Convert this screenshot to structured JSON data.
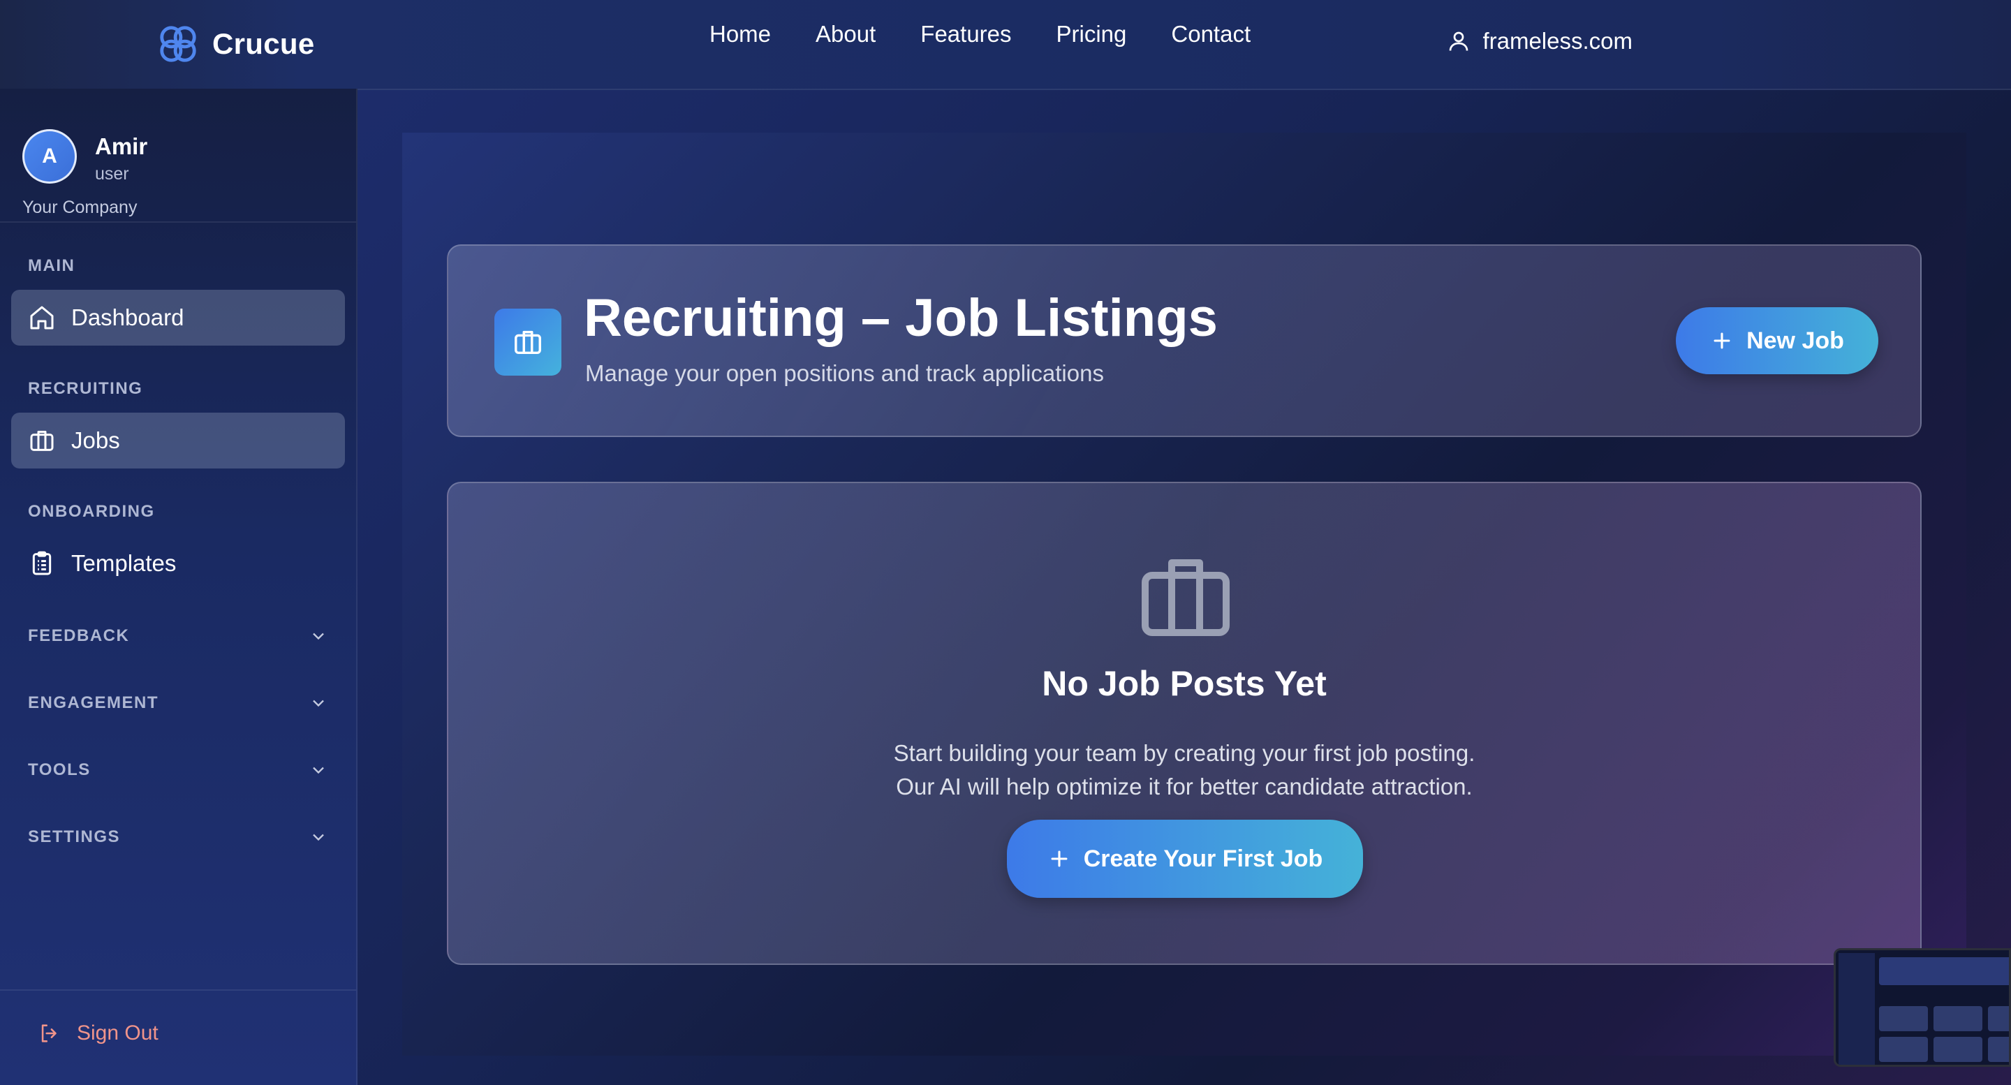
{
  "brand": {
    "name": "Crucue"
  },
  "nav": {
    "links": [
      "Home",
      "About",
      "Features",
      "Pricing",
      "Contact"
    ]
  },
  "account": {
    "label": "frameless.com"
  },
  "profile": {
    "initial": "A",
    "name": "Amir",
    "role": "user",
    "company": "Your Company"
  },
  "sidebar": {
    "sections": {
      "main": "MAIN",
      "recruiting": "RECRUITING",
      "onboarding": "ONBOARDING",
      "feedback": "FEEDBACK",
      "engagement": "ENGAGEMENT",
      "tools": "TOOLS",
      "settings": "SETTINGS"
    },
    "items": {
      "dashboard": "Dashboard",
      "jobs": "Jobs",
      "templates": "Templates"
    },
    "sign_out": "Sign Out"
  },
  "header": {
    "title": "Recruiting – Job Listings",
    "subtitle": "Manage your open positions and track applications",
    "new_job": "New Job"
  },
  "empty_state": {
    "title": "No Job Posts Yet",
    "line1": "Start building your team by creating your first job posting.",
    "line2": "Our AI will help optimize it for better candidate attraction.",
    "button": "Create Your First Job"
  },
  "colors": {
    "accent_start": "#3d7ae8",
    "accent_end": "#45b2d8",
    "signout": "#f0948a"
  }
}
